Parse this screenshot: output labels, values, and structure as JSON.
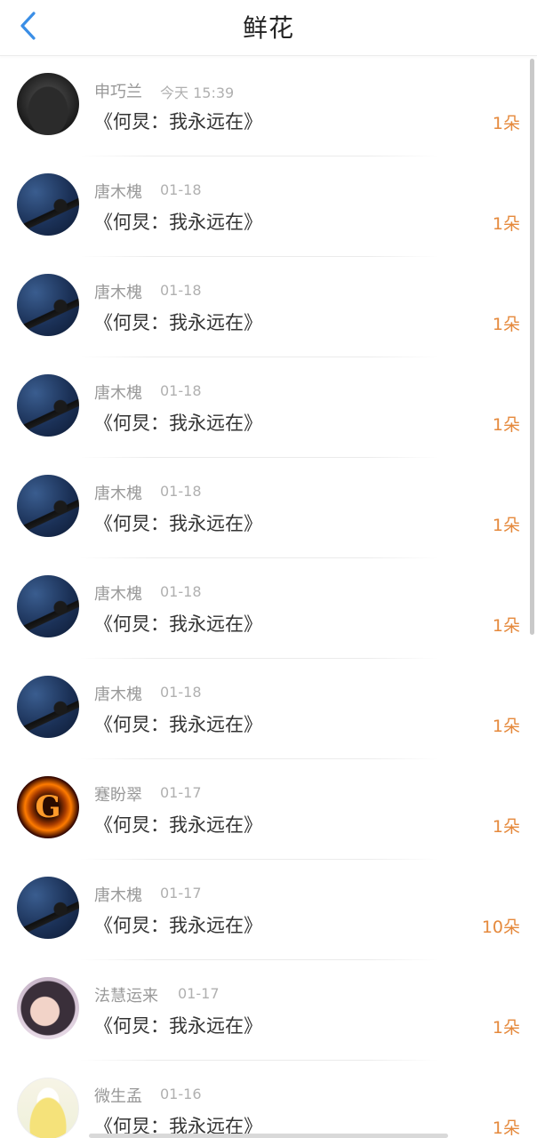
{
  "header": {
    "title": "鲜花",
    "back_icon": "chevron-left-icon",
    "accent": "#3a8ee6"
  },
  "colors": {
    "count": "#e5893c",
    "name": "#999999",
    "text": "#333333"
  },
  "rows": [
    {
      "avatar": "hood",
      "name": "申巧兰",
      "time": "今天 15:39",
      "book": "《何炅：我永远在》",
      "count": "1朵"
    },
    {
      "avatar": "sea",
      "name": "唐木槐",
      "time": "01-18",
      "book": "《何炅：我永远在》",
      "count": "1朵"
    },
    {
      "avatar": "sea",
      "name": "唐木槐",
      "time": "01-18",
      "book": "《何炅：我永远在》",
      "count": "1朵"
    },
    {
      "avatar": "sea",
      "name": "唐木槐",
      "time": "01-18",
      "book": "《何炅：我永远在》",
      "count": "1朵"
    },
    {
      "avatar": "sea",
      "name": "唐木槐",
      "time": "01-18",
      "book": "《何炅：我永远在》",
      "count": "1朵"
    },
    {
      "avatar": "sea",
      "name": "唐木槐",
      "time": "01-18",
      "book": "《何炅：我永远在》",
      "count": "1朵"
    },
    {
      "avatar": "sea",
      "name": "唐木槐",
      "time": "01-18",
      "book": "《何炅：我永远在》",
      "count": "1朵"
    },
    {
      "avatar": "g",
      "name": "蹇盼翠",
      "time": "01-17",
      "book": "《何炅：我永远在》",
      "count": "1朵"
    },
    {
      "avatar": "sea",
      "name": "唐木槐",
      "time": "01-17",
      "book": "《何炅：我永远在》",
      "count": "10朵"
    },
    {
      "avatar": "girl",
      "name": "法慧运来",
      "time": "01-17",
      "book": "《何炅：我永远在》",
      "count": "1朵"
    },
    {
      "avatar": "dress",
      "name": "微生孟",
      "time": "01-16",
      "book": "《何炅：我永远在》",
      "count": "1朵"
    }
  ]
}
